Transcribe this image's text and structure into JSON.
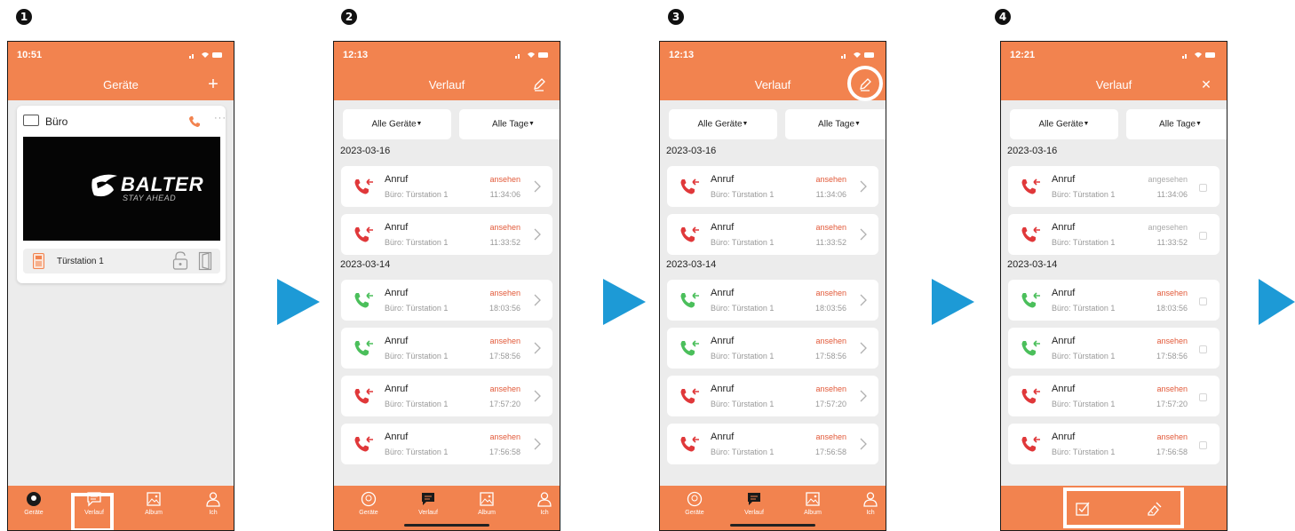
{
  "steps": [
    "1",
    "2",
    "3",
    "4"
  ],
  "accent_color": "#f2834f",
  "arrow_color": "#1d9ad6",
  "screen1": {
    "time": "10:51",
    "title": "Geräte",
    "add_label": "+",
    "device": {
      "name": "Büro",
      "more": "···",
      "brand": "BALTER",
      "tagline": "STAY AHEAD",
      "station": "Türstation 1"
    },
    "tabs": [
      "Geräte",
      "Verlauf",
      "Album",
      "Ich"
    ]
  },
  "screen2": {
    "time": "12:13",
    "title": "Verlauf",
    "filter_devices": "Alle Geräte",
    "filter_days": "Alle Tage",
    "dates": [
      "2023-03-16",
      "2023-03-14"
    ],
    "calls": [
      {
        "title": "Anruf",
        "sub": "Büro: Türstation 1",
        "status": "ansehen",
        "time": "11:34:06",
        "missed": true
      },
      {
        "title": "Anruf",
        "sub": "Büro: Türstation 1",
        "status": "ansehen",
        "time": "11:33:52",
        "missed": true
      },
      {
        "title": "Anruf",
        "sub": "Büro: Türstation 1",
        "status": "ansehen",
        "time": "18:03:56",
        "missed": false
      },
      {
        "title": "Anruf",
        "sub": "Büro: Türstation 1",
        "status": "ansehen",
        "time": "17:58:56",
        "missed": false
      },
      {
        "title": "Anruf",
        "sub": "Büro: Türstation 1",
        "status": "ansehen",
        "time": "17:57:20",
        "missed": true
      },
      {
        "title": "Anruf",
        "sub": "Büro: Türstation 1",
        "status": "ansehen",
        "time": "17:56:58",
        "missed": true
      }
    ],
    "tabs": [
      "Geräte",
      "Verlauf",
      "Album",
      "Ich"
    ]
  },
  "screen3": {
    "time": "12:13",
    "title": "Verlauf",
    "filter_devices": "Alle Geräte",
    "filter_days": "Alle Tage",
    "dates": [
      "2023-03-16",
      "2023-03-14"
    ],
    "calls": [
      {
        "title": "Anruf",
        "sub": "Büro: Türstation 1",
        "status": "ansehen",
        "time": "11:34:06",
        "missed": true
      },
      {
        "title": "Anruf",
        "sub": "Büro: Türstation 1",
        "status": "ansehen",
        "time": "11:33:52",
        "missed": true
      },
      {
        "title": "Anruf",
        "sub": "Büro: Türstation 1",
        "status": "ansehen",
        "time": "18:03:56",
        "missed": false
      },
      {
        "title": "Anruf",
        "sub": "Büro: Türstation 1",
        "status": "ansehen",
        "time": "17:58:56",
        "missed": false
      },
      {
        "title": "Anruf",
        "sub": "Büro: Türstation 1",
        "status": "ansehen",
        "time": "17:57:20",
        "missed": true
      },
      {
        "title": "Anruf",
        "sub": "Büro: Türstation 1",
        "status": "ansehen",
        "time": "17:56:58",
        "missed": true
      }
    ],
    "tabs": [
      "Geräte",
      "Verlauf",
      "Album",
      "Ich"
    ]
  },
  "screen4": {
    "time": "12:21",
    "title": "Verlauf",
    "close_label": "✕",
    "filter_devices": "Alle Geräte",
    "filter_days": "Alle Tage",
    "dates": [
      "2023-03-16",
      "2023-03-14"
    ],
    "calls": [
      {
        "title": "Anruf",
        "sub": "Büro: Türstation 1",
        "status": "angesehen",
        "time": "11:34:06",
        "missed": true
      },
      {
        "title": "Anruf",
        "sub": "Büro: Türstation 1",
        "status": "angesehen",
        "time": "11:33:52",
        "missed": true
      },
      {
        "title": "Anruf",
        "sub": "Büro: Türstation 1",
        "status": "ansehen",
        "time": "18:03:56",
        "missed": false
      },
      {
        "title": "Anruf",
        "sub": "Büro: Türstation 1",
        "status": "ansehen",
        "time": "17:58:56",
        "missed": false
      },
      {
        "title": "Anruf",
        "sub": "Büro: Türstation 1",
        "status": "ansehen",
        "time": "17:57:20",
        "missed": true
      },
      {
        "title": "Anruf",
        "sub": "Büro: Türstation 1",
        "status": "ansehen",
        "time": "17:56:58",
        "missed": true
      }
    ]
  }
}
